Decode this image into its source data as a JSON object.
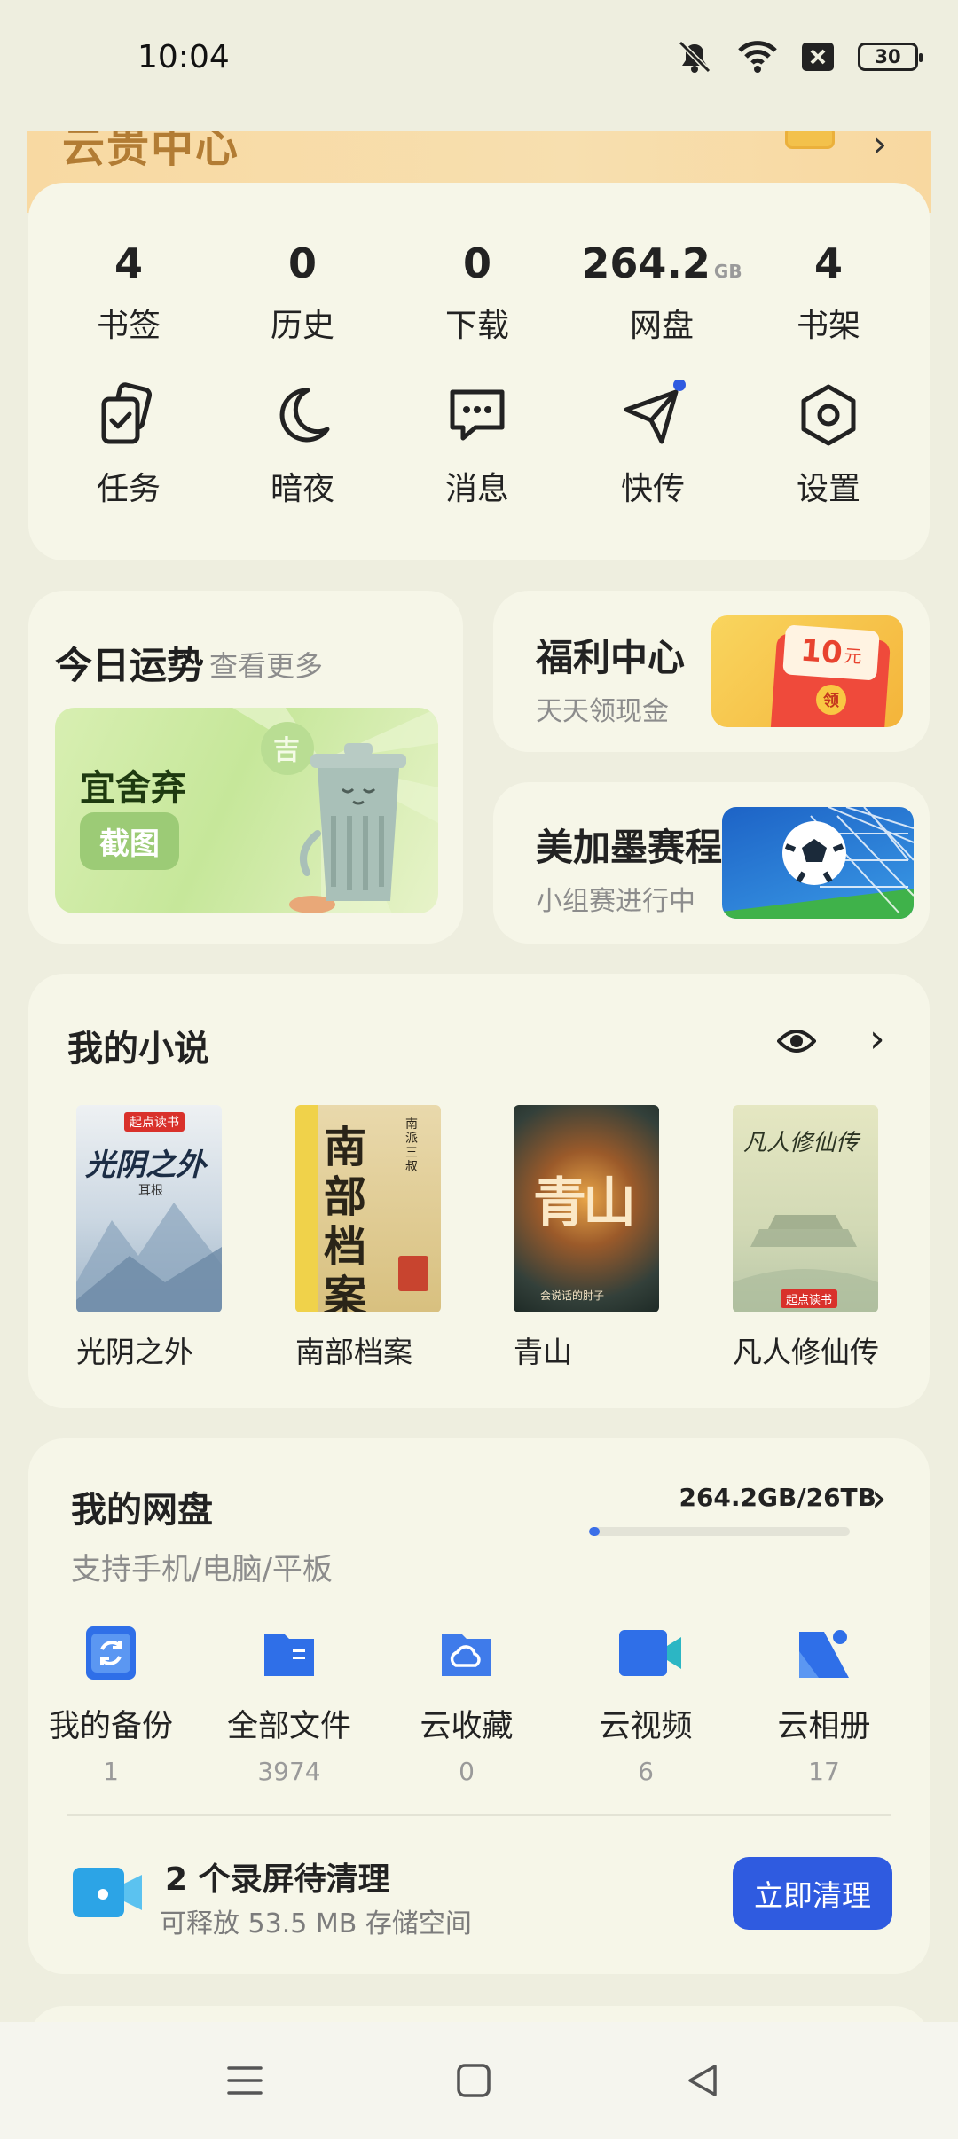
{
  "status_bar": {
    "time": "10:04",
    "battery": "30"
  },
  "vip": {
    "title": "云贵中心"
  },
  "stats": [
    {
      "value": "4",
      "unit": "",
      "label": "书签"
    },
    {
      "value": "0",
      "unit": "",
      "label": "历史"
    },
    {
      "value": "0",
      "unit": "",
      "label": "下载"
    },
    {
      "value": "264.2",
      "unit": "GB",
      "label": "网盘"
    },
    {
      "value": "4",
      "unit": "",
      "label": "书架"
    }
  ],
  "tools": [
    {
      "label": "任务",
      "icon": "task-icon"
    },
    {
      "label": "暗夜",
      "icon": "moon-icon"
    },
    {
      "label": "消息",
      "icon": "message-icon"
    },
    {
      "label": "快传",
      "icon": "send-icon"
    },
    {
      "label": "设置",
      "icon": "settings-icon"
    }
  ],
  "fortune": {
    "title": "今日运势",
    "more": "查看更多",
    "advice": "宜舍弃",
    "button": "截图",
    "badge": "吉"
  },
  "welfare": {
    "title": "福利中心",
    "subtitle": "天天领现金",
    "amount": "10",
    "unit": "元",
    "tag": "领"
  },
  "worldcup": {
    "title": "美加墨赛程",
    "subtitle": "小组赛进行中"
  },
  "novels": {
    "title": "我的小说",
    "books": [
      {
        "name": "光阴之外",
        "cover_text": "光阴之外",
        "author": "耳根",
        "publisher": "起点读书"
      },
      {
        "name": "南部档案",
        "cover_text": "南部档案",
        "author": "南派三叔"
      },
      {
        "name": "青山",
        "cover_text": "青山",
        "author": "会说话的肘子"
      },
      {
        "name": "凡人修仙传",
        "cover_text": "凡人修仙传",
        "publisher": "起点读书"
      }
    ]
  },
  "disk": {
    "title": "我的网盘",
    "subtitle": "支持手机/电脑/平板",
    "usage": "264.2GB/26TB",
    "usage_fraction": 0.04,
    "items": [
      {
        "label": "我的备份",
        "count": "1",
        "icon": "backup-icon"
      },
      {
        "label": "全部文件",
        "count": "3974",
        "icon": "folder-icon"
      },
      {
        "label": "云收藏",
        "count": "0",
        "icon": "cloud-folder-icon"
      },
      {
        "label": "云视频",
        "count": "6",
        "icon": "video-icon"
      },
      {
        "label": "云相册",
        "count": "17",
        "icon": "album-icon"
      }
    ],
    "clean": {
      "title": "2 个录屏待清理",
      "subtitle": "可释放 53.5 MB 存储空间",
      "button": "立即清理"
    }
  },
  "colors": {
    "accent": "#2F5BE0",
    "card": "#F6F6E8",
    "background": "#EEEEDF"
  }
}
